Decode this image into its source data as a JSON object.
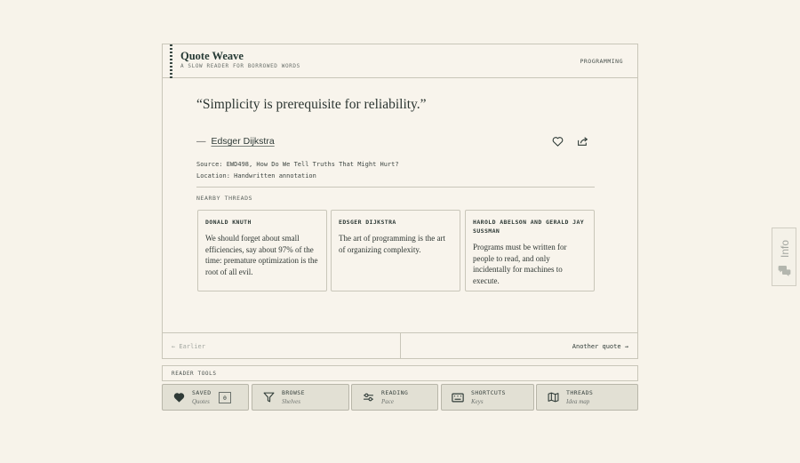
{
  "app": {
    "title": "Quote Weave",
    "subtitle": "A SLOW READER FOR BORROWED WORDS",
    "category": "PROGRAMMING"
  },
  "quote": {
    "text": "“Simplicity is prerequisite for reliability.”",
    "dash": "—",
    "author": "Edsger Dijkstra",
    "source": "Source: EWD498, How Do We Tell Truths That Might Hurt?",
    "location": "Location: Handwritten annotation"
  },
  "nearby": {
    "label": "NEARBY THREADS",
    "items": [
      {
        "author": "Donald Knuth",
        "text": "We should forget about small efficiencies, say about 97% of the time: premature optimization is the root of all evil."
      },
      {
        "author": "Edsger Dijkstra",
        "text": "The art of programming is the art of organizing complexity."
      },
      {
        "author": "Harold Abelson and Gerald Jay Sussman",
        "text": "Programs must be written for people to read, and only incidentally for machines to execute."
      }
    ]
  },
  "pager": {
    "prev": "← Earlier",
    "next": "Another quote →"
  },
  "tools": {
    "label": "READER TOOLS",
    "items": [
      {
        "label": "SAVED",
        "sub": "Quotes",
        "icon": "heart-filled-icon",
        "count": "0"
      },
      {
        "label": "BROWSE",
        "sub": "Shelves",
        "icon": "filter-icon"
      },
      {
        "label": "READING",
        "sub": "Pace",
        "icon": "sliders-icon"
      },
      {
        "label": "SHORTCUTS",
        "sub": "Keys",
        "icon": "keyboard-icon"
      },
      {
        "label": "THREADS",
        "sub": "Idea map",
        "icon": "map-icon"
      }
    ]
  },
  "info_tab": {
    "label": "Info",
    "icon": "chat-bubbles-icon"
  },
  "colors": {
    "background": "#f7f3ea",
    "ink": "#2e3a36",
    "border": "#c9c6b9",
    "tool_bg": "#e2e0d4"
  }
}
